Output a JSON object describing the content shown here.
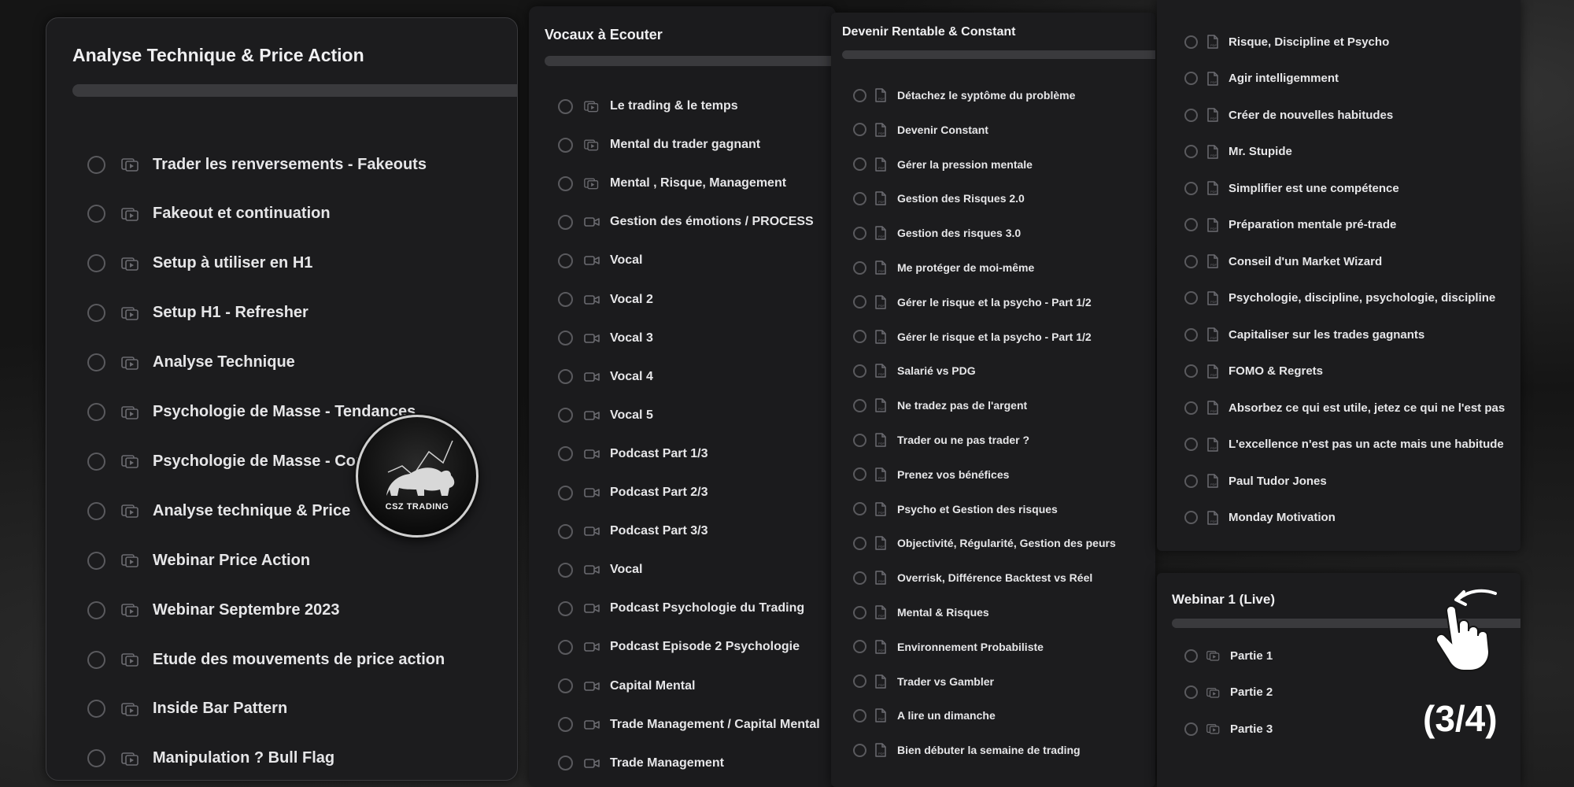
{
  "panels": [
    {
      "title": "Analyse Technique & Price Action",
      "item_icon": "video-file-icon",
      "items": [
        "Trader les renversements - Fakeouts",
        "Fakeout et continuation",
        "Setup à utiliser en H1",
        "Setup H1 - Refresher",
        "Analyse Technique",
        "Psychologie de Masse - Tendances",
        "Psychologie de Masse - Cons",
        "Analyse technique & Price",
        "Webinar Price Action",
        "Webinar Septembre 2023",
        "Etude des mouvements de price action",
        "Inside Bar Pattern",
        "Manipulation ? Bull Flag"
      ]
    },
    {
      "title": "Vocaux à Ecouter",
      "items": [
        {
          "label": "Le trading & le temps",
          "icon": "video-file-icon"
        },
        {
          "label": "Mental du trader gagnant",
          "icon": "video-file-icon"
        },
        {
          "label": "Mental , Risque, Management",
          "icon": "video-file-icon"
        },
        {
          "label": "Gestion des émotions / PROCESS",
          "icon": "video-camera-icon"
        },
        {
          "label": "Vocal",
          "icon": "video-camera-icon"
        },
        {
          "label": "Vocal 2",
          "icon": "video-camera-icon"
        },
        {
          "label": "Vocal 3",
          "icon": "video-camera-icon"
        },
        {
          "label": "Vocal 4",
          "icon": "video-camera-icon"
        },
        {
          "label": "Vocal 5",
          "icon": "video-camera-icon"
        },
        {
          "label": "Podcast Part 1/3",
          "icon": "video-camera-icon"
        },
        {
          "label": "Podcast Part 2/3",
          "icon": "video-camera-icon"
        },
        {
          "label": "Podcast Part 3/3",
          "icon": "video-camera-icon"
        },
        {
          "label": "Vocal",
          "icon": "video-camera-icon"
        },
        {
          "label": "Podcast Psychologie du Trading",
          "icon": "video-camera-icon"
        },
        {
          "label": "Podcast Episode 2 Psychologie",
          "icon": "video-camera-icon"
        },
        {
          "label": "Capital Mental",
          "icon": "video-camera-icon"
        },
        {
          "label": "Trade Management / Capital Mental",
          "icon": "video-camera-icon"
        },
        {
          "label": "Trade Management",
          "icon": "video-camera-icon"
        }
      ]
    },
    {
      "title": "Devenir Rentable & Constant",
      "item_icon": "pdf-file-icon",
      "items": [
        "Détachez le syptôme du problème",
        "Devenir Constant",
        "Gérer la pression mentale",
        "Gestion des Risques 2.0",
        "Gestion des risques 3.0",
        "Me protéger de moi-même",
        "Gérer le risque et la psycho - Part 1/2",
        "Gérer le risque et la psycho - Part 1/2",
        "Salarié vs PDG",
        "Ne tradez pas de l'argent",
        "Trader ou ne pas trader ?",
        "Prenez vos bénéfices",
        "Psycho et Gestion des risques",
        "Objectivité, Régularité, Gestion des peurs",
        "Overrisk, Différence Backtest vs Réel",
        "Mental & Risques",
        "Environnement Probabiliste",
        "Trader vs Gambler",
        "A lire un dimanche",
        "Bien débuter la semaine de trading"
      ]
    },
    {
      "title": "",
      "item_icon": "pdf-file-icon",
      "items": [
        "Risque, Discipline et Psycho",
        "Agir intelligemment",
        "Créer de nouvelles habitudes",
        "Mr. Stupide",
        "Simplifier est une compétence",
        "Préparation mentale pré-trade",
        "Conseil d'un Market Wizard",
        "Psychologie, discipline, psychologie, discipline",
        "Capitaliser sur les trades gagnants",
        "FOMO & Regrets",
        "Absorbez ce qui est utile, jetez ce qui ne l'est pas",
        "L'excellence n'est pas un acte mais une habitude",
        "Paul Tudor Jones",
        "Monday Motivation"
      ]
    },
    {
      "title": "Webinar 1 (Live)",
      "item_icon": "video-file-icon",
      "items": [
        "Partie 1",
        "Partie 2",
        "Partie 3"
      ]
    }
  ],
  "logo": {
    "text": "CSZ TRADING",
    "icon": "bear-logo-icon"
  },
  "gesture_icon": "swipe-hand-icon",
  "page_counter": "(3/4)"
}
